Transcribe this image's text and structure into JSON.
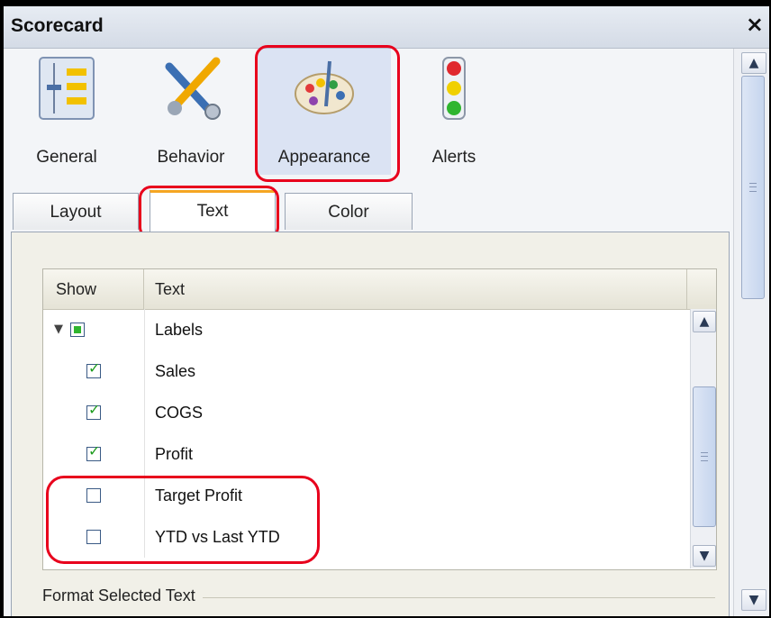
{
  "window": {
    "title": "Scorecard",
    "close_glyph": "×"
  },
  "categories": [
    {
      "label": "General",
      "icon": "general-settings-icon"
    },
    {
      "label": "Behavior",
      "icon": "tools-icon"
    },
    {
      "label": "Appearance",
      "icon": "palette-icon",
      "selected": true
    },
    {
      "label": "Alerts",
      "icon": "traffic-light-icon"
    }
  ],
  "tabs": [
    {
      "label": "Layout"
    },
    {
      "label": "Text",
      "selected": true
    },
    {
      "label": "Color"
    }
  ],
  "grid": {
    "columns": [
      "Show",
      "Text"
    ],
    "rows": [
      {
        "text": "Labels",
        "state": "partial",
        "expanded": true
      },
      {
        "text": "Sales",
        "state": "checked"
      },
      {
        "text": "COGS",
        "state": "checked"
      },
      {
        "text": "Profit",
        "state": "checked"
      },
      {
        "text": "Target Profit",
        "state": "unchecked"
      },
      {
        "text": "YTD vs Last YTD",
        "state": "unchecked"
      }
    ]
  },
  "format_section": {
    "label": "Format Selected Text"
  },
  "colors": {
    "highlight": "#e8001c",
    "accent_tab": "#f5a623",
    "check": "#1e9c1e"
  }
}
